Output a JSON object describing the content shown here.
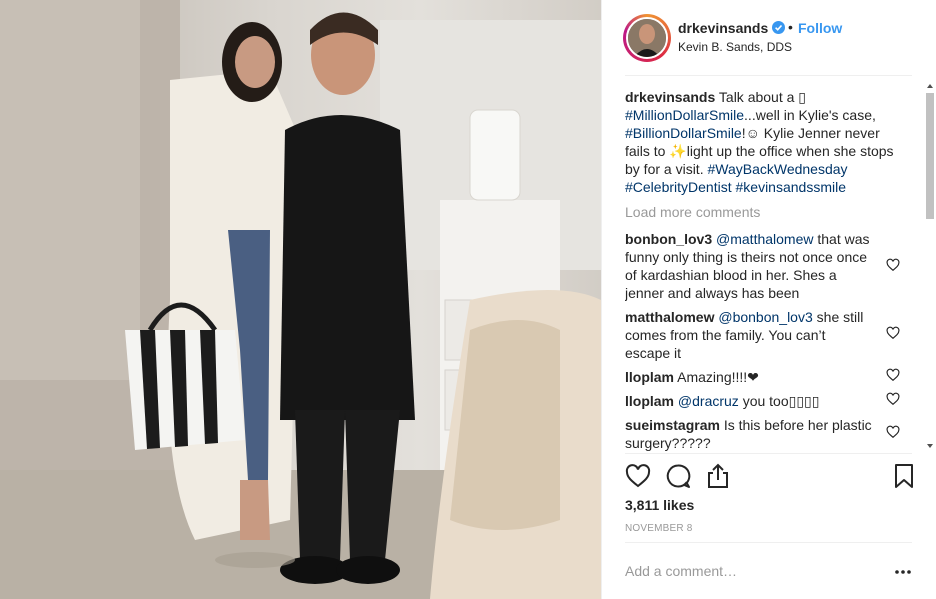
{
  "post": {
    "username": "drkevinsands",
    "full_name": "Kevin B. Sands, DDS",
    "separator": "•",
    "follow_label": "Follow",
    "verified_icon": "verified-badge-icon",
    "caption": {
      "user": "drkevinsands",
      "t1": " Talk about a ",
      "e1": "▯",
      "tag1": "#MillionDollarSmile",
      "t2": "...well in Kylie's case, ",
      "tag2": "#BillionDollarSmile",
      "t3": "!☺ Kylie Jenner never fails to ✨light up the office when she stops by for a visit. ",
      "tag3": "#WayBackWednesday",
      "sp": " ",
      "tag4": "#CelebrityDentist",
      "tag5": "#kevinsandssmile"
    },
    "load_more": "Load more comments",
    "comments": [
      {
        "user": "bonbon_lov3",
        "mention": "@matthalomew",
        "text": " that was funny only thing is theirs not once once of kardashian blood in her. Shes a jenner and always has been"
      },
      {
        "user": "matthalomew",
        "mention": "@bonbon_lov3",
        "text": " she still comes from the family. You can’t escape it"
      },
      {
        "user": "lloplam",
        "mention": "",
        "text": " Amazing!!!!❤"
      },
      {
        "user": "lloplam",
        "mention": "@dracruz",
        "text": " you too▯▯▯▯"
      },
      {
        "user": "sueimstagram",
        "mention": "",
        "text": " Is this before her plastic surgery?????"
      }
    ],
    "likes": "3,811 likes",
    "date": "NOVEMBER 8",
    "add_comment_placeholder": "Add a comment…",
    "icons": {
      "like": "heart-icon",
      "comment": "comment-icon",
      "share": "share-icon",
      "save": "bookmark-icon",
      "more": "more-options-icon"
    },
    "colors": {
      "link": "#003569",
      "follow": "#3897f0",
      "verified": "#3897f0",
      "muted": "#999999"
    }
  }
}
